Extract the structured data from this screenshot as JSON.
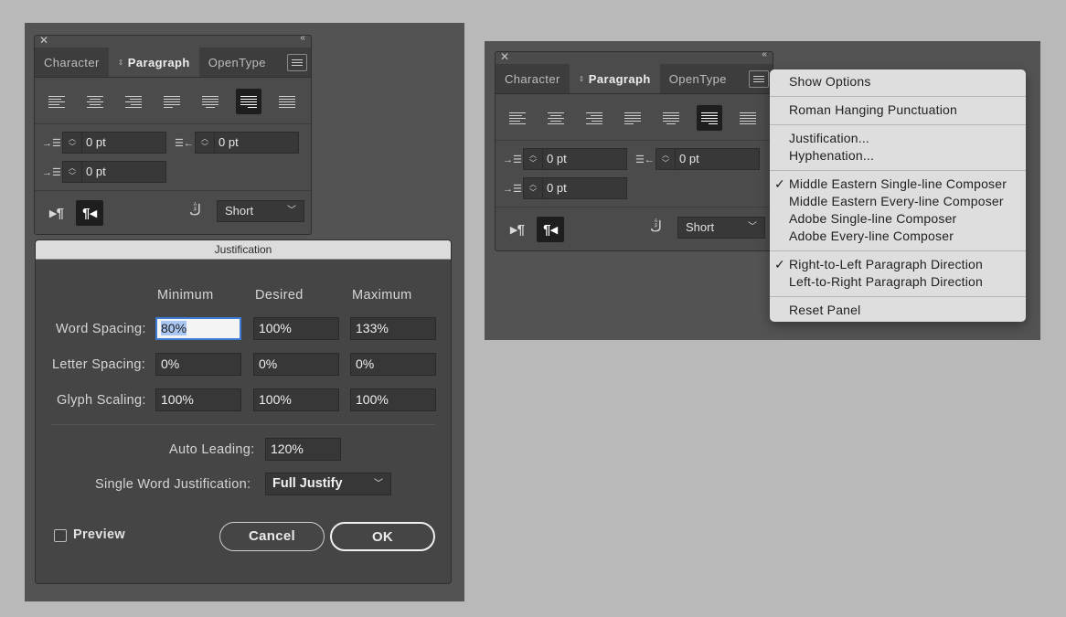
{
  "panel": {
    "tabs": [
      "Character",
      "Paragraph",
      "OpenType"
    ],
    "indent_left": "0 pt",
    "indent_right": "0 pt",
    "indent_first": "0 pt",
    "kashida": "Short"
  },
  "dialog": {
    "title": "Justification",
    "col_min": "Minimum",
    "col_desired": "Desired",
    "col_max": "Maximum",
    "word_spacing_label": "Word Spacing:",
    "word_min": "80%",
    "word_desired": "100%",
    "word_max": "133%",
    "letter_spacing_label": "Letter Spacing:",
    "letter_min": "0%",
    "letter_desired": "0%",
    "letter_max": "0%",
    "glyph_scaling_label": "Glyph Scaling:",
    "glyph_min": "100%",
    "glyph_desired": "100%",
    "glyph_max": "100%",
    "auto_leading_label": "Auto Leading:",
    "auto_leading": "120%",
    "single_word_label": "Single Word Justification:",
    "single_word": "Full Justify",
    "preview_label": "Preview",
    "cancel": "Cancel",
    "ok": "OK"
  },
  "menu": {
    "show_options": "Show Options",
    "roman_hanging": "Roman Hanging Punctuation",
    "justification": "Justification...",
    "hyphenation": "Hyphenation...",
    "me_single": "Middle Eastern Single-line Composer",
    "me_every": "Middle Eastern Every-line Composer",
    "adobe_single": "Adobe Single-line Composer",
    "adobe_every": "Adobe Every-line Composer",
    "rtl": "Right-to-Left Paragraph Direction",
    "ltr": "Left-to-Right Paragraph Direction",
    "reset": "Reset Panel",
    "checkmark": "✓"
  }
}
